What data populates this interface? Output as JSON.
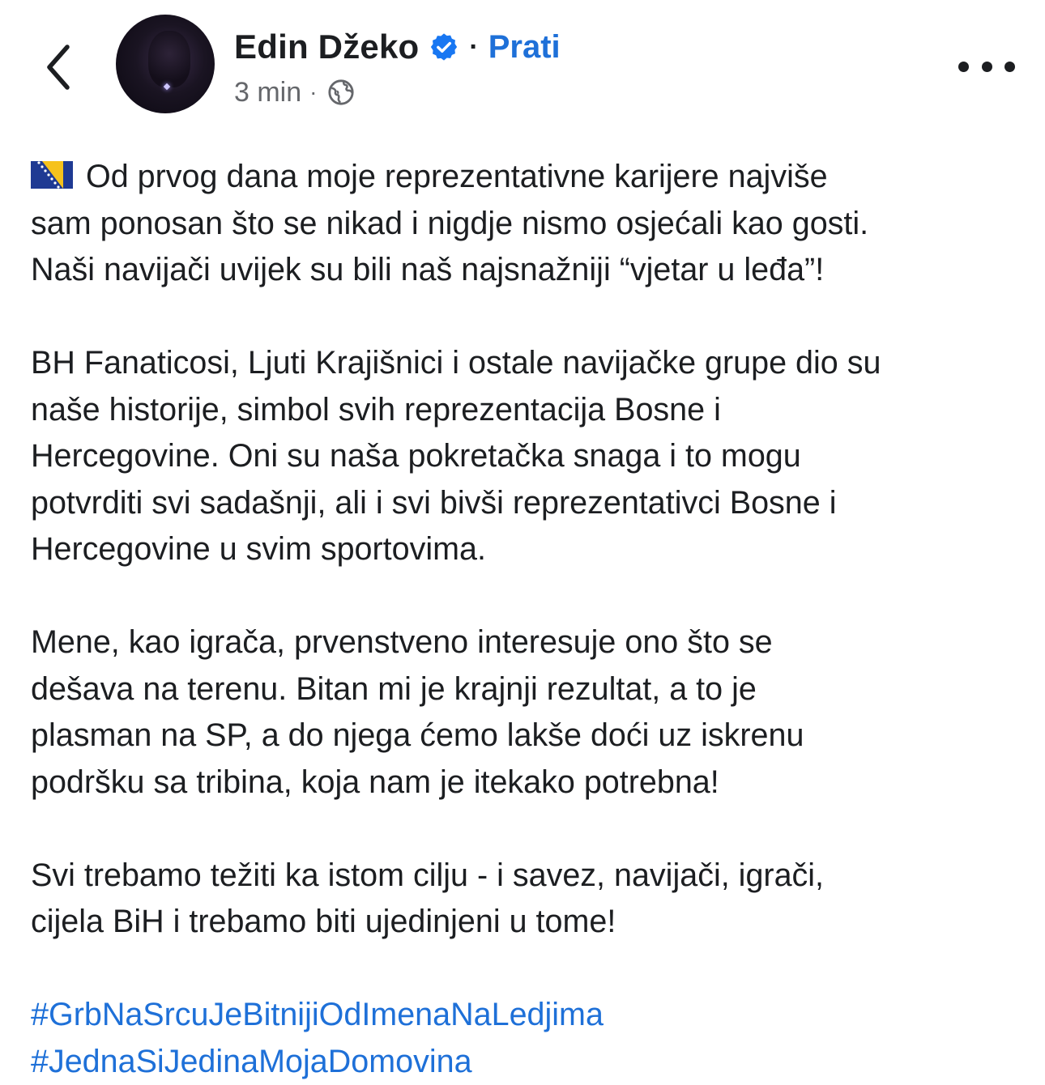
{
  "header": {
    "author_name": "Edin Džeko",
    "separator": "·",
    "follow_label": "Prati",
    "timestamp": "3 min",
    "meta_separator": "·",
    "privacy_icon": "globe-icon",
    "back_icon": "chevron-left-icon",
    "verified_icon": "verified-badge-icon",
    "more_icon": "more-horizontal-icon"
  },
  "post": {
    "flag_icon": "bosnia-flag-icon",
    "paragraphs": [
      {
        "lines": [
          "Od prvog dana moje reprezentativne karijere najviše",
          "sam ponosan što se nikad i nigdje nismo osjećali kao gosti.",
          "Naši navijači uvijek su bili naš najsnažniji “vjetar u leđa”!"
        ]
      },
      {
        "lines": [
          "BH Fanaticosi, Ljuti Krajišnici i ostale navijačke grupe dio su",
          "naše historije, simbol svih reprezentacija Bosne i",
          "Hercegovine. Oni su naša pokretačka snaga i to mogu",
          "potvrditi svi sadašnji, ali i svi bivši reprezentativci Bosne i",
          "Hercegovine u svim sportovima."
        ]
      },
      {
        "lines": [
          "Mene, kao igrača, prvenstveno interesuje ono što se",
          "dešava na terenu. Bitan mi je krajnji rezultat, a to je",
          "plasman na SP, a do njega ćemo lakše doći uz iskrenu",
          "podršku sa tribina, koja nam je itekako potrebna!"
        ]
      },
      {
        "lines": [
          "Svi trebamo težiti ka istom cilju - i savez, navijači, igrači,",
          "cijela BiH i trebamo biti ujedinjeni u tome!"
        ]
      }
    ],
    "hashtags": [
      "#GrbNaSrcuJeBitnijiOdImenaNaLedjima",
      "#JednaSiJedinaMojaDomovina"
    ]
  },
  "colors": {
    "text": "#1c1e21",
    "secondary_text": "#65676b",
    "link": "#1e70d8",
    "verified": "#1877f2",
    "flag_blue": "#1f3a93",
    "flag_yellow": "#f6c21c"
  }
}
